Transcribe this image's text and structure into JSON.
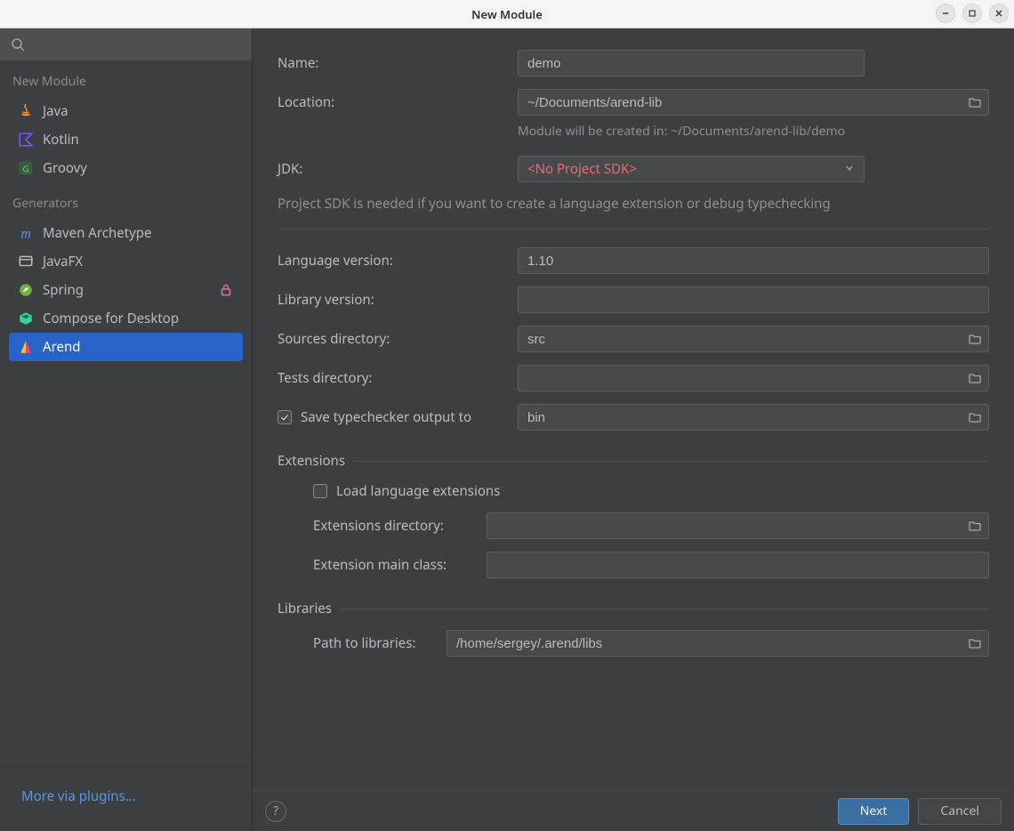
{
  "window": {
    "title": "New Module"
  },
  "sidebar": {
    "section_new_module": "New Module",
    "items_lang": [
      {
        "label": "Java"
      },
      {
        "label": "Kotlin"
      },
      {
        "label": "Groovy"
      }
    ],
    "section_generators": "Generators",
    "items_gen": [
      {
        "label": "Maven Archetype"
      },
      {
        "label": "JavaFX"
      },
      {
        "label": "Spring",
        "locked": true
      },
      {
        "label": "Compose for Desktop"
      },
      {
        "label": "Arend",
        "selected": true
      }
    ],
    "more_link": "More via plugins..."
  },
  "form": {
    "name_label": "Name:",
    "name_value": "demo",
    "location_label": "Location:",
    "location_value": "~/Documents/arend-lib",
    "location_hint": "Module will be created in: ~/Documents/arend-lib/demo",
    "jdk_label": "JDK:",
    "jdk_value": "<No Project SDK>",
    "jdk_hint": "Project SDK is needed if you want to create a language extension or debug typechecking",
    "lang_version_label": "Language version:",
    "lang_version_value": "1.10",
    "lib_version_label": "Library version:",
    "lib_version_value": "",
    "sources_label": "Sources directory:",
    "sources_value": "src",
    "tests_label": "Tests directory:",
    "tests_value": "",
    "save_typecheck_label": "Save typechecker output to",
    "save_typecheck_checked": true,
    "save_typecheck_value": "bin",
    "extensions_group": "Extensions",
    "load_ext_label": "Load language extensions",
    "load_ext_checked": false,
    "ext_dir_label": "Extensions directory:",
    "ext_dir_value": "",
    "ext_main_label": "Extension main class:",
    "ext_main_value": "",
    "libraries_group": "Libraries",
    "path_libs_label": "Path to libraries:",
    "path_libs_value": "/home/sergey/.arend/libs"
  },
  "footer": {
    "next": "Next",
    "cancel": "Cancel"
  }
}
